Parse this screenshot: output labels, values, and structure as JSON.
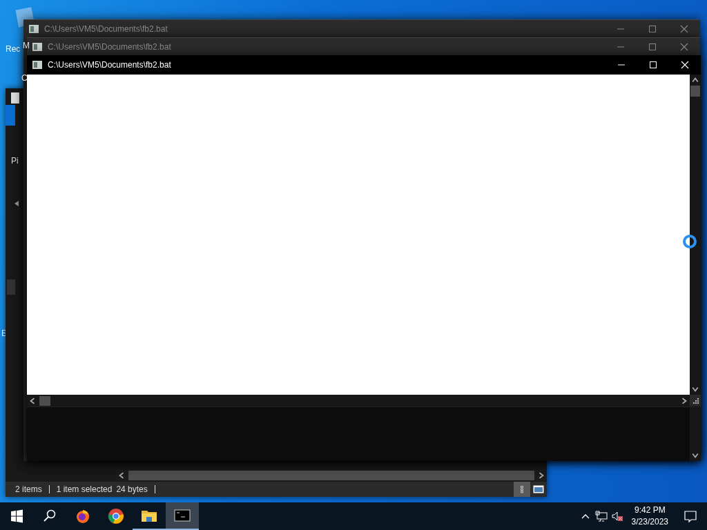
{
  "desktop": {
    "icon_labels": [
      "Rec",
      "E"
    ]
  },
  "background_window": {
    "fragments": [
      "M",
      "C"
    ]
  },
  "explorer_window": {
    "nav_fragment": "Pi",
    "status_bar": {
      "item_count": "2 items",
      "selection": "1 item selected",
      "size": "24 bytes"
    },
    "view_buttons": [
      {
        "kind": "details",
        "selected": true
      },
      {
        "kind": "thumbnails",
        "selected": false
      }
    ]
  },
  "console_windows": [
    {
      "title": "C:\\Users\\VM5\\Documents\\fb2.bat",
      "active": false
    },
    {
      "title": "C:\\Users\\VM5\\Documents\\fb2.bat",
      "active": false
    },
    {
      "title": "C:\\Users\\VM5\\Documents\\fb2.bat",
      "active": true
    }
  ],
  "taskbar": {
    "apps": [
      {
        "kind": "firefox",
        "running": false,
        "selected": false
      },
      {
        "kind": "chrome",
        "running": false,
        "selected": false
      },
      {
        "kind": "explorer",
        "running": true,
        "selected": false
      },
      {
        "kind": "console",
        "running": true,
        "selected": true
      }
    ],
    "clock": {
      "time": "9:42 PM",
      "date": "3/23/2023"
    }
  }
}
